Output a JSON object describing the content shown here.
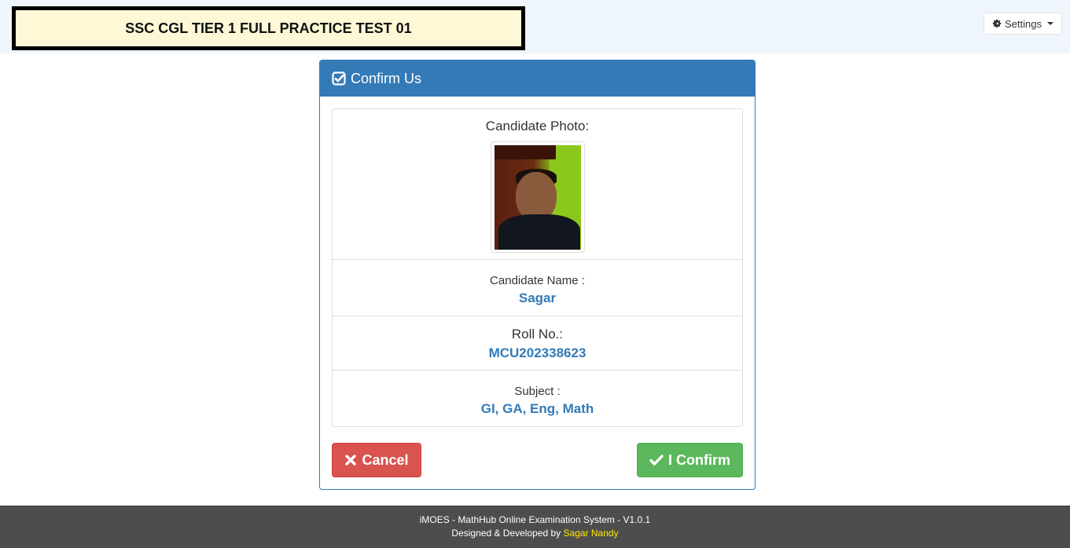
{
  "header": {
    "exam_title": "SSC CGL TIER 1 FULL PRACTICE TEST 01",
    "settings_label": "Settings"
  },
  "panel": {
    "title": "Confirm Us",
    "photo_label": "Candidate Photo:",
    "name_label": "Candidate Name :",
    "name_value": "Sagar",
    "roll_label": "Roll No.:",
    "roll_value": "MCU202338623",
    "subject_label": "Subject :",
    "subject_value": "GI, GA, Eng, Math"
  },
  "buttons": {
    "cancel_label": "Cancel",
    "confirm_label": "I Confirm"
  },
  "footer": {
    "line1": "iMOES - MathHub Online Examination System - V1.0.1",
    "line2_prefix": "Designed & Developed by",
    "author": "Sagar Nandy"
  },
  "colors": {
    "primary": "#337ab7",
    "danger": "#d9534f",
    "success": "#5cb85c",
    "title_bg": "#fff8d6",
    "topbar_bg": "#eef5fc",
    "footer_bg": "#4d4d4d",
    "footer_author": "#ffeb00"
  },
  "icons": {
    "settings": "gear-icon",
    "panel_title": "check-square-icon",
    "cancel": "close-icon",
    "confirm": "check-icon"
  }
}
